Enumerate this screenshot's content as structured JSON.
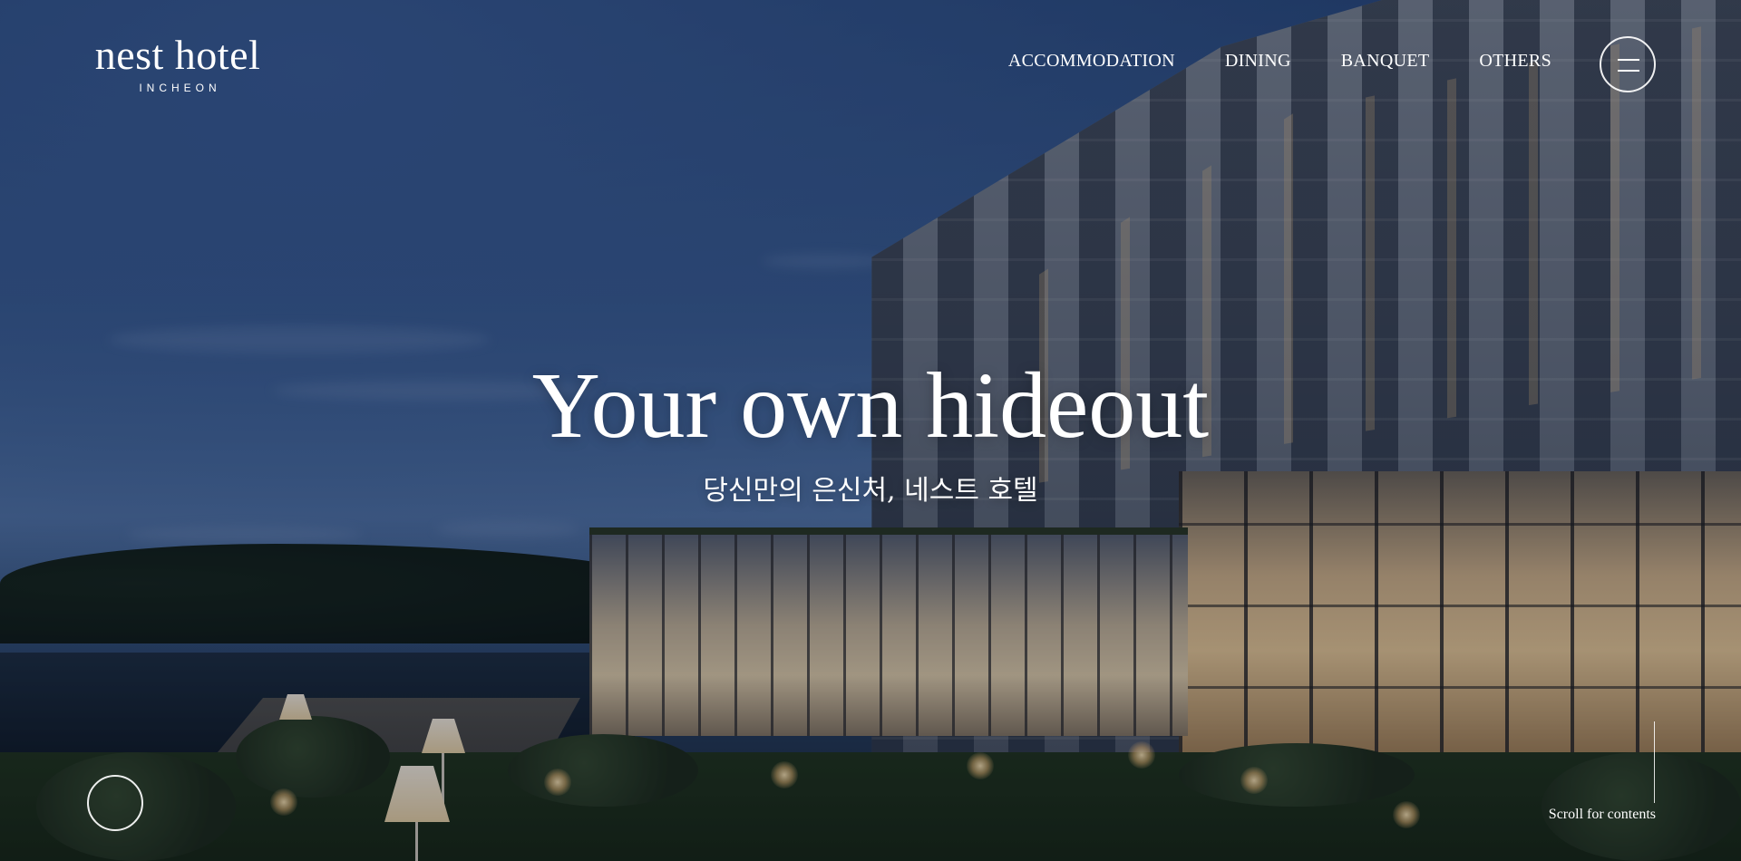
{
  "header": {
    "logo": {
      "name": "nest hotel",
      "city": "INCHEON"
    },
    "nav": {
      "items": [
        {
          "label": "ACCOMMODATION"
        },
        {
          "label": "DINING"
        },
        {
          "label": "BANQUET"
        },
        {
          "label": "OTHERS"
        }
      ]
    },
    "menu_icon": "hamburger-menu-icon"
  },
  "hero": {
    "headline": "Your own hideout",
    "subline": "당신만의 은신처, 네스트 호텔"
  },
  "footer_controls": {
    "scroll_label": "Scroll for contents"
  },
  "colors": {
    "text": "#ffffff",
    "sky": "#2a4b7f",
    "overlay": "#081026"
  }
}
